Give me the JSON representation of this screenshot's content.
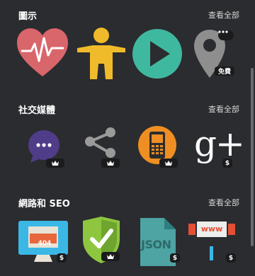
{
  "sections": [
    {
      "title": "圖示",
      "see_all": "查看全部"
    },
    {
      "title": "社交媒體",
      "see_all": "查看全部"
    },
    {
      "title": "網路和 SEO",
      "see_all": "查看全部"
    }
  ],
  "icons": {
    "free_badge": "免費",
    "dollar": "$",
    "not_found_code": "404",
    "json_label": "JSON",
    "www_label": "www",
    "gplus_label": "g+"
  },
  "colors": {
    "background": "#2b2c2f",
    "heart": "#d9666b",
    "person": "#f0bb2b",
    "play": "#3fb8a0",
    "pin": "#8e8e8e",
    "chat": "#4f3d8a",
    "phone": "#ef8f23",
    "shield": "#8ec63f",
    "json_doc": "#4ea3a3",
    "monitor": "#3bb7e6"
  }
}
